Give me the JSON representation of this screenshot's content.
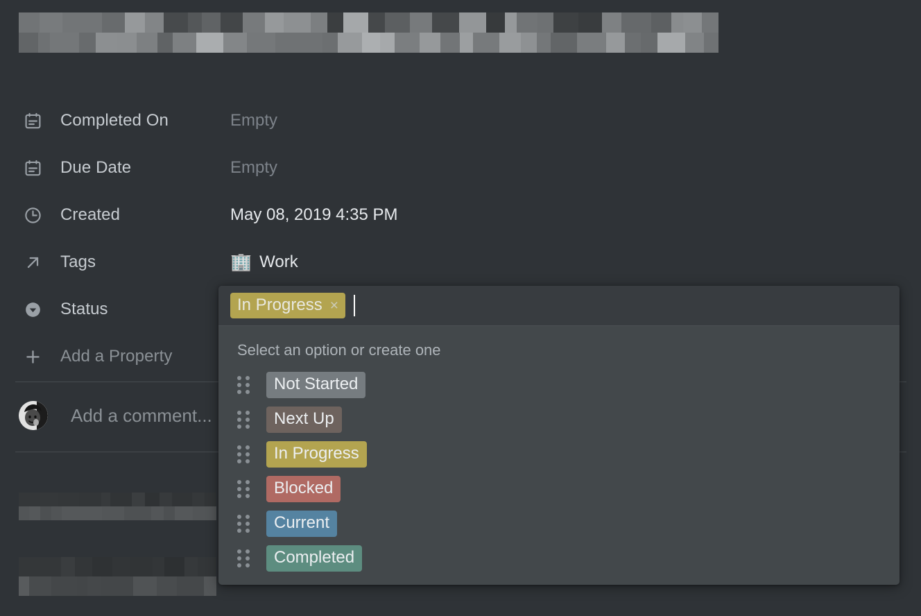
{
  "page": {
    "background_color": "#2f3337",
    "title_redacted": true
  },
  "properties": [
    {
      "icon": "calendar-note-icon",
      "label": "Completed On",
      "value": "Empty",
      "is_empty": true
    },
    {
      "icon": "calendar-note-icon",
      "label": "Due Date",
      "value": "Empty",
      "is_empty": true
    },
    {
      "icon": "clock-icon",
      "label": "Created",
      "value": "May 08, 2019 4:35 PM",
      "is_empty": false
    },
    {
      "icon": "arrow-up-right-icon",
      "label": "Tags",
      "value": "Work",
      "emoji": "🏢",
      "is_empty": false
    },
    {
      "icon": "chevron-down-circle-icon",
      "label": "Status",
      "value": "",
      "is_empty": false
    }
  ],
  "add_property": {
    "icon": "plus-icon",
    "label": "Add a Property"
  },
  "comment": {
    "avatar": "user-avatar",
    "placeholder": "Add a comment..."
  },
  "status_picker": {
    "selected_chip": {
      "label": "In Progress",
      "color": "#b3a450",
      "remove_icon": "close-icon",
      "remove_label": "×"
    },
    "hint": "Select an option or create one",
    "options": [
      {
        "label": "Not Started",
        "color": "#767c80",
        "handle": "drag-handle-icon"
      },
      {
        "label": "Next Up",
        "color": "#6e635e",
        "handle": "drag-handle-icon"
      },
      {
        "label": "In Progress",
        "color": "#b3a450",
        "handle": "drag-handle-icon"
      },
      {
        "label": "Blocked",
        "color": "#b06a63",
        "handle": "drag-handle-icon"
      },
      {
        "label": "Current",
        "color": "#5583a1",
        "handle": "drag-handle-icon"
      },
      {
        "label": "Completed",
        "color": "#5d8d80",
        "handle": "drag-handle-icon"
      }
    ]
  }
}
